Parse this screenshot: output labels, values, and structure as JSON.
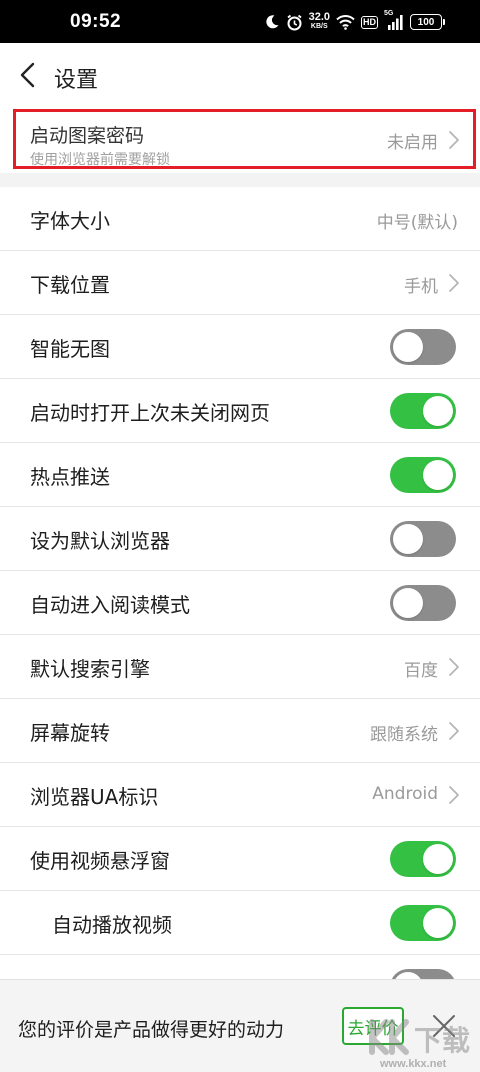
{
  "status_bar": {
    "time": "09:52",
    "net_speed_value": "32.0",
    "net_speed_unit": "KB/S",
    "hd_badge": "HD",
    "signal_label": "5G",
    "battery": "100",
    "icons": [
      "moon-icon",
      "alarm-icon",
      "wifi-icon",
      "hd-icon",
      "signal-icon",
      "battery-icon"
    ]
  },
  "header": {
    "title": "设置"
  },
  "pattern_password": {
    "title": "启动图案密码",
    "subtitle": "使用浏览器前需要解锁",
    "value": "未启用",
    "highlight_color": "#e41e26"
  },
  "settings": [
    {
      "label": "字体大小",
      "type": "value",
      "value": "中号(默认)",
      "chevron": false
    },
    {
      "label": "下载位置",
      "type": "value",
      "value": "手机",
      "chevron": true
    },
    {
      "label": "智能无图",
      "type": "toggle",
      "on": false
    },
    {
      "label": "启动时打开上次未关闭网页",
      "type": "toggle",
      "on": true
    },
    {
      "label": "热点推送",
      "type": "toggle",
      "on": true
    },
    {
      "label": "设为默认浏览器",
      "type": "toggle",
      "on": false
    },
    {
      "label": "自动进入阅读模式",
      "type": "toggle",
      "on": false
    },
    {
      "label": "默认搜索引擎",
      "type": "value",
      "value": "百度",
      "chevron": true
    },
    {
      "label": "屏幕旋转",
      "type": "value",
      "value": "跟随系统",
      "chevron": true
    },
    {
      "label": "浏览器UA标识",
      "type": "value",
      "value": "Android",
      "chevron": true
    },
    {
      "label": "使用视频悬浮窗",
      "type": "toggle",
      "on": true
    },
    {
      "label": "自动播放视频",
      "type": "toggle",
      "on": true,
      "indent": true
    },
    {
      "label": "",
      "type": "toggle",
      "on": false
    }
  ],
  "rating_banner": {
    "text": "您的评价是产品做得更好的动力",
    "button": "去评价"
  },
  "watermark": {
    "text": "www.kkx.net",
    "logo_text": "下载"
  },
  "colors": {
    "toggle_on": "#34c043",
    "toggle_off": "#8c8c8c",
    "accent_green": "#2aa832",
    "secondary_text": "#9a9a9a"
  }
}
